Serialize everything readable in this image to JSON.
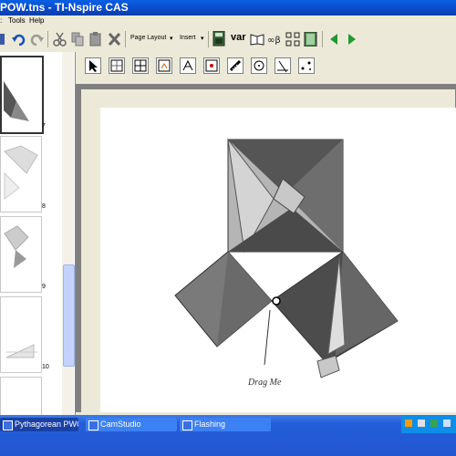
{
  "window": {
    "title": "POW.tns - TI-Nspire CAS"
  },
  "menu": {
    "items": [
      "Tools",
      "Help"
    ]
  },
  "toolbar": {
    "page_layout_label": "Page Layout",
    "insert_label": "Insert",
    "var_label": "var"
  },
  "sidebar": {
    "pages": [
      {
        "number": "7",
        "selected": true
      },
      {
        "number": "8",
        "selected": false
      },
      {
        "number": "9",
        "selected": false
      },
      {
        "number": "10",
        "selected": false
      },
      {
        "number": "",
        "selected": false
      }
    ]
  },
  "figure": {
    "annotation": "Drag Me"
  },
  "taskbar": {
    "items": [
      {
        "label": "Pythagorean PWOW..."
      },
      {
        "label": "CamStudio"
      },
      {
        "label": "Flashing"
      }
    ]
  },
  "colors": {
    "title_bar": "#0a49c8",
    "taskbar": "#245edb",
    "canvas_bg": "#7f7f7f",
    "accent_green": "#1f9a2f"
  }
}
